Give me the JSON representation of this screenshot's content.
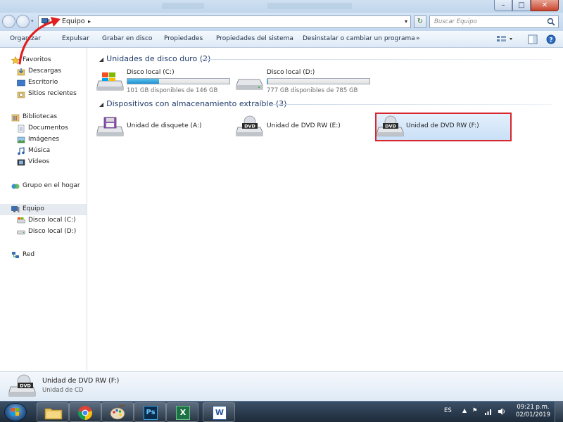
{
  "window": {
    "controls": {
      "minimize": "–",
      "maximize": "□",
      "close": "✕"
    }
  },
  "address": {
    "breadcrumb": [
      "Equipo"
    ],
    "search_placeholder": "Buscar Equipo"
  },
  "toolbar": {
    "organize": "Organizar",
    "eject": "Expulsar",
    "burn": "Grabar en disco",
    "properties": "Propiedades",
    "system_properties": "Propiedades del sistema",
    "uninstall": "Desinstalar o cambiar un programa",
    "more": "»"
  },
  "navigation": {
    "favorites": {
      "header": "Favoritos",
      "items": [
        "Descargas",
        "Escritorio",
        "Sitios recientes"
      ]
    },
    "libraries": {
      "header": "Bibliotecas",
      "items": [
        "Documentos",
        "Imágenes",
        "Música",
        "Vídeos"
      ]
    },
    "homegroup": "Grupo en el hogar",
    "computer": {
      "header": "Equipo",
      "items": [
        "Disco local (C:)",
        "Disco local (D:)"
      ]
    },
    "network": "Red"
  },
  "content": {
    "hard_drives": {
      "header": "Unidades de disco duro (2)",
      "drives": [
        {
          "name": "Disco local (C:)",
          "free": "101 GB disponibles de 146 GB",
          "used_fraction": 0.31,
          "bar_color": "#2a9ad8"
        },
        {
          "name": "Disco local (D:)",
          "free": "777 GB disponibles de 785 GB",
          "used_fraction": 0.01,
          "bar_color": "#2a9ad8"
        }
      ]
    },
    "removable": {
      "header": "Dispositivos con almacenamiento extraíble (3)",
      "devices": [
        {
          "name": "Unidad de disquete (A:)",
          "icon": "floppy-drive-icon"
        },
        {
          "name": "Unidad de DVD RW (E:)",
          "icon": "dvd-drive-icon"
        },
        {
          "name": "Unidad de DVD RW (F:)",
          "icon": "dvd-drive-icon",
          "selected": true,
          "highlight_color": "#d6262e"
        }
      ]
    }
  },
  "details": {
    "title": "Unidad de DVD RW (F:)",
    "subtitle": "Unidad de CD"
  },
  "taskbar": {
    "apps": [
      "explorer",
      "chrome",
      "paint",
      "photoshop",
      "excel",
      "word"
    ],
    "photoshop_label": "Ps",
    "excel_label": "X",
    "word_label": "W",
    "language": "ES",
    "time": "09:21 p.m.",
    "date": "02/01/2019"
  },
  "annotation": {
    "arrow_color": "#e02020"
  }
}
